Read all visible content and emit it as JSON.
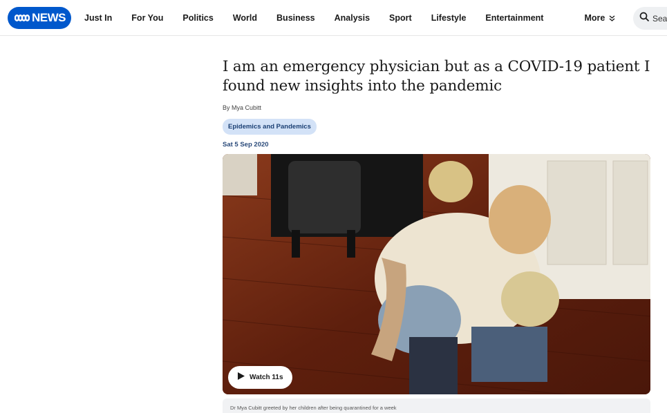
{
  "header": {
    "logo_text": "NEWS",
    "brand_color": "#0058cc",
    "nav": [
      {
        "label": "Just In"
      },
      {
        "label": "For You"
      },
      {
        "label": "Politics"
      },
      {
        "label": "World"
      },
      {
        "label": "Business"
      },
      {
        "label": "Analysis"
      },
      {
        "label": "Sport"
      },
      {
        "label": "Lifestyle"
      },
      {
        "label": "Entertainment"
      }
    ],
    "more_label": "More",
    "search_label": "Sea"
  },
  "article": {
    "headline": "I am an emergency physician but as a COVID-19 patient I found new insights into the pandemic",
    "byline": "By Mya Cubitt",
    "tag": "Epidemics and Pandemics",
    "date": "Sat 5 Sep 2020",
    "video": {
      "watch_label": "Watch 11s"
    },
    "caption": "Dr Mya Cubitt greeted by her children after being quarantined for a week"
  }
}
